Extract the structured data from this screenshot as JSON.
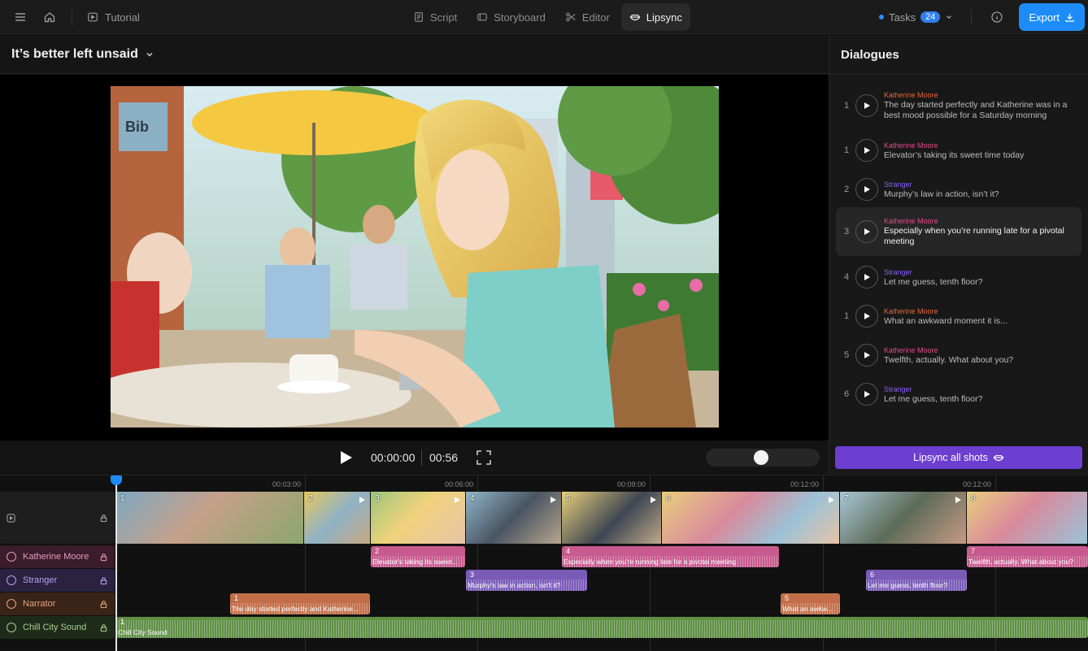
{
  "topbar": {
    "tutorial_label": "Tutorial",
    "tabs": [
      {
        "label": "Script",
        "icon": "script-icon"
      },
      {
        "label": "Storyboard",
        "icon": "storyboard-icon"
      },
      {
        "label": "Editor",
        "icon": "scissors-icon"
      },
      {
        "label": "Lipsync",
        "icon": "lips-icon",
        "active": true
      }
    ],
    "tasks_label": "Tasks",
    "tasks_count": "24",
    "export_label": "Export"
  },
  "project": {
    "title": "It’s better left unsaid"
  },
  "player": {
    "current_time": "00:00:00",
    "duration": "00:56",
    "zoom_level": 0.48
  },
  "dialogues": {
    "title": "Dialogues",
    "items": [
      {
        "n": "1",
        "speaker": "Katherine Moore",
        "color": "#e0683a",
        "text": "The day started perfectly and Katherine was in a best mood possible for a Saturday morning"
      },
      {
        "n": "1",
        "speaker": "Katherine Moore",
        "color": "#e04a8a",
        "text": "Elevator’s taking its sweet time today"
      },
      {
        "n": "2",
        "speaker": "Stranger",
        "color": "#8b5cf6",
        "text": "Murphy’s law in action, isn’t it?"
      },
      {
        "n": "3",
        "speaker": "Katherine Moore",
        "color": "#e04a8a",
        "text": "Especially when you’re running late for a pivotal meeting",
        "selected": true
      },
      {
        "n": "4",
        "speaker": "Stranger",
        "color": "#8b5cf6",
        "text": "Let me guess, tenth floor?"
      },
      {
        "n": "1",
        "speaker": "Katherine Moore",
        "color": "#e0683a",
        "text": "What an awkward moment it is..."
      },
      {
        "n": "5",
        "speaker": "Katherine Moore",
        "color": "#e04a8a",
        "text": "Twelfth, actually. What about you?"
      },
      {
        "n": "6",
        "speaker": "Stranger",
        "color": "#8b5cf6",
        "text": "Let me guess, tenth floor?"
      }
    ],
    "lipsync_all_label": "Lipsync all shots"
  },
  "timeline": {
    "ticks": [
      "00:03:00",
      "00:06:00",
      "00:09:00",
      "00:12:00",
      "00:12:00"
    ],
    "tracks": [
      {
        "name": "Katherine Moore",
        "color": "#e04a8a"
      },
      {
        "name": "Stranger",
        "color": "#8b5cf6"
      },
      {
        "name": "Narrator",
        "color": "#e0683a"
      },
      {
        "name": "Chill City Sound",
        "color": "#6aa84f"
      }
    ],
    "shots": [
      "1",
      "2",
      "3",
      "4",
      "5",
      "6",
      "7",
      "8"
    ],
    "clips": {
      "k2": {
        "num": "2",
        "label": "Elevator's taking its sweet..."
      },
      "k4": {
        "num": "4",
        "label": "Especially when you're running late for a pivotal meeting"
      },
      "k7": {
        "num": "7",
        "label": "Twelfth, actually. What about you?"
      },
      "s3": {
        "num": "3",
        "label": "Murphy's law in action, isn't it?"
      },
      "s6": {
        "num": "6",
        "label": "Let me guess, tenth floor?"
      },
      "n1": {
        "num": "1",
        "label": "The day started perfectly and Katherine..."
      },
      "n5": {
        "num": "5",
        "label": "What an awkw..."
      },
      "m1": {
        "num": "1",
        "label": "Chill City Sound"
      }
    }
  }
}
